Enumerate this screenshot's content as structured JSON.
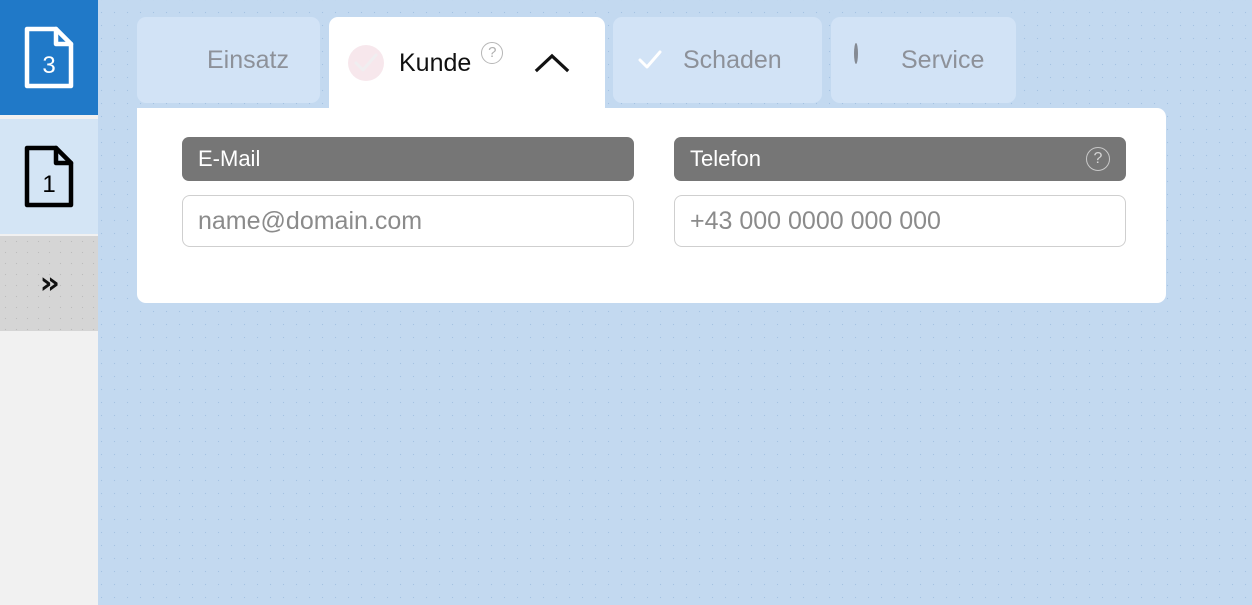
{
  "colors": {
    "background": "#c3d9f0",
    "sidebar_active": "#2079c8",
    "sidebar_item": "#d4e5f5",
    "sidebar_expand": "#d5d5d5",
    "tab_inactive": "#d2e3f6",
    "tab_active": "#ffffff",
    "field_label_bar": "#767676",
    "status_gray": "#7d8590",
    "text_muted": "#8d9199"
  },
  "sidebar": {
    "items": [
      {
        "name": "document-3",
        "badge": "3",
        "icon": "document-icon",
        "state": "active"
      },
      {
        "name": "document-1",
        "badge": "1",
        "icon": "document-icon",
        "state": "inactive"
      },
      {
        "name": "expand-sidebar",
        "icon": "double-chevron-right-icon",
        "label": "»",
        "state": "default"
      }
    ]
  },
  "tabs": [
    {
      "label": "Einsatz",
      "status_icon": "pie-quarter-icon",
      "active": false
    },
    {
      "label": "Kunde",
      "status_icon": "checkbox-checked-icon",
      "active": true,
      "help_icon": "question-mark-icon",
      "collapse_icon": "chevron-up-icon"
    },
    {
      "label": "Schaden",
      "status_icon": "checkbox-checked-icon",
      "active": false
    },
    {
      "label": "Service",
      "status_icon": "circle-empty-icon",
      "active": false
    }
  ],
  "panel": {
    "fields": [
      {
        "label": "E-Mail",
        "value": "",
        "placeholder": "name@domain.com",
        "has_help": false
      },
      {
        "label": "Telefon",
        "value": "",
        "placeholder": "+43 000 0000 000 000",
        "has_help": true,
        "help_icon": "question-mark-icon",
        "help_label": "?"
      }
    ]
  },
  "glyphs": {
    "question_mark": "?",
    "double_chevron": "»"
  }
}
